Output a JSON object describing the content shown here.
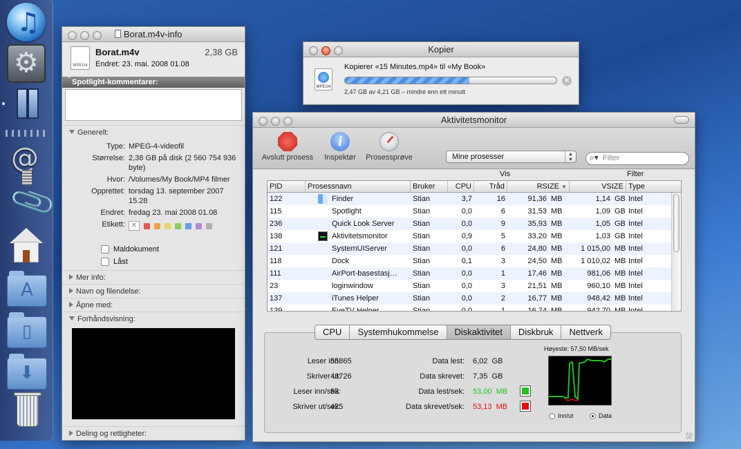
{
  "dock": {
    "items": [
      "itunes-icon",
      "system-preferences-icon",
      "spaces-icon",
      "mail-icon",
      "paperclip-icon",
      "home-icon",
      "applications-folder-icon",
      "documents-folder-icon",
      "downloads-folder-icon",
      "trash-icon"
    ]
  },
  "info_window": {
    "title": "Borat.m4v-info",
    "icon_label": "MPEG4",
    "file_name": "Borat.m4v",
    "file_size": "2,38 GB",
    "modified": "Endret: 23. mai. 2008 01.08",
    "spotlight_header": "Spotlight-kommentarer:",
    "general_header": "Generelt:",
    "general": [
      {
        "key": "Type:",
        "value": "MPEG-4-videofil"
      },
      {
        "key": "Størrelse:",
        "value": "2,38 GB på disk (2 560 754 936 byte)"
      },
      {
        "key": "Hvor:",
        "value": "/Volumes/My Book/MP4 filmer"
      },
      {
        "key": "Opprettet:",
        "value": "torsdag 13. september 2007 15.28"
      },
      {
        "key": "Endret:",
        "value": "fredag 23. mai 2008 01.08"
      }
    ],
    "label_key": "Etikett:",
    "label_colors": [
      "#e05a4f",
      "#e8a54a",
      "#e6d36a",
      "#8fcc5a",
      "#6a9ee6",
      "#b08ad6",
      "#b0b0b0"
    ],
    "checkbox_stationery": "Maldokument",
    "checkbox_locked": "Låst",
    "more_info": "Mer info:",
    "name_ext": "Navn og filendelse:",
    "open_with": "Åpne med:",
    "preview": "Forhåndsvisning:",
    "sharing": "Deling og rettigheter:"
  },
  "copy_window": {
    "title": "Kopier",
    "icon_label": "MPEG4",
    "text": "Kopierer «15 Minutes.mp4» til «My Book»",
    "progress_fraction": 0.587,
    "status": "2,47 GB av 4,21 GB – mindre enn ett minutt"
  },
  "activity_monitor": {
    "title": "Aktivitetsmonitor",
    "toolbar": {
      "quit_label": "Avslutt prosess",
      "inspect_label": "Inspektør",
      "sample_label": "Prosessprøve",
      "show_value": "Mine prosesser",
      "show_label": "Vis",
      "filter_placeholder": "Filter",
      "filter_label": "Filter"
    },
    "columns": {
      "pid": "PID",
      "name": "Prosessnavn",
      "user": "Bruker",
      "cpu": "CPU",
      "threads": "Tråd",
      "rsize": "RSIZE",
      "vsize": "VSIZE",
      "type": "Type"
    },
    "rows": [
      {
        "pid": "122",
        "name": "Finder",
        "icon": "finder",
        "user": "Stian",
        "cpu": "3,7",
        "threads": "16",
        "rsize": "91,36",
        "rsize_unit": "MB",
        "vsize": "1,14",
        "vsize_unit": "GB",
        "type": "Intel"
      },
      {
        "pid": "115",
        "name": "Spotlight",
        "icon": "blank",
        "user": "Stian",
        "cpu": "0,0",
        "threads": "6",
        "rsize": "31,53",
        "rsize_unit": "MB",
        "vsize": "1,09",
        "vsize_unit": "GB",
        "type": "Intel"
      },
      {
        "pid": "236",
        "name": "Quick Look Server",
        "icon": "blank",
        "user": "Stian",
        "cpu": "0,0",
        "threads": "9",
        "rsize": "35,93",
        "rsize_unit": "MB",
        "vsize": "1,05",
        "vsize_unit": "GB",
        "type": "Intel"
      },
      {
        "pid": "138",
        "name": "Aktivitetsmonitor",
        "icon": "am",
        "user": "Stian",
        "cpu": "0,9",
        "threads": "5",
        "rsize": "33,20",
        "rsize_unit": "MB",
        "vsize": "1,03",
        "vsize_unit": "GB",
        "type": "Intel"
      },
      {
        "pid": "121",
        "name": "SystemUIServer",
        "icon": "blank",
        "user": "Stian",
        "cpu": "0,0",
        "threads": "6",
        "rsize": "24,80",
        "rsize_unit": "MB",
        "vsize": "1 015,00",
        "vsize_unit": "MB",
        "type": "Intel"
      },
      {
        "pid": "118",
        "name": "Dock",
        "icon": "blank",
        "user": "Stian",
        "cpu": "0,1",
        "threads": "3",
        "rsize": "24,50",
        "rsize_unit": "MB",
        "vsize": "1 010,02",
        "vsize_unit": "MB",
        "type": "Intel"
      },
      {
        "pid": "111",
        "name": "AirPort-basestasj…",
        "icon": "blank",
        "user": "Stian",
        "cpu": "0,0",
        "threads": "1",
        "rsize": "17,46",
        "rsize_unit": "MB",
        "vsize": "981,06",
        "vsize_unit": "MB",
        "type": "Intel"
      },
      {
        "pid": "23",
        "name": "loginwindow",
        "icon": "blank",
        "user": "Stian",
        "cpu": "0,0",
        "threads": "3",
        "rsize": "21,51",
        "rsize_unit": "MB",
        "vsize": "960,10",
        "vsize_unit": "MB",
        "type": "Intel"
      },
      {
        "pid": "137",
        "name": "iTunes Helper",
        "icon": "blank",
        "user": "Stian",
        "cpu": "0,0",
        "threads": "2",
        "rsize": "16,77",
        "rsize_unit": "MB",
        "vsize": "948,42",
        "vsize_unit": "MB",
        "type": "Intel"
      },
      {
        "pid": "139",
        "name": "EyeTV Helper",
        "icon": "blank",
        "user": "Stian",
        "cpu": "0,0",
        "threads": "1",
        "rsize": "16,74",
        "rsize_unit": "MB",
        "vsize": "942,70",
        "vsize_unit": "MB",
        "type": "Intel"
      }
    ],
    "tabs": [
      "CPU",
      "Systemhukommelse",
      "Diskaktivitet",
      "Diskbruk",
      "Nettverk"
    ],
    "active_tab": "Diskaktivitet",
    "disk": {
      "reads_in_label": "Leser inn:",
      "reads_in": "55865",
      "writes_out_label": "Skriver ut:",
      "writes_out": "43726",
      "reads_sec_label": "Leser inn/sek:",
      "reads_sec": "53",
      "writes_sec_label": "Skriver ut/sek:",
      "writes_sec": "425",
      "data_read_label": "Data lest:",
      "data_read": "6,02  GB",
      "data_written_label": "Data skrevet:",
      "data_written": "7,35  GB",
      "data_read_sec_label": "Data lest/sek:",
      "data_read_sec": "53,00  MB",
      "data_written_sec_label": "Data skrevet/sek:",
      "data_written_sec": "53,13  MB",
      "read_color": "#20c020",
      "write_color": "#e01010",
      "peak": "Høyeste: 57,50  MB/sek",
      "radio_io": "Inn/ut",
      "radio_data": "Data"
    }
  }
}
